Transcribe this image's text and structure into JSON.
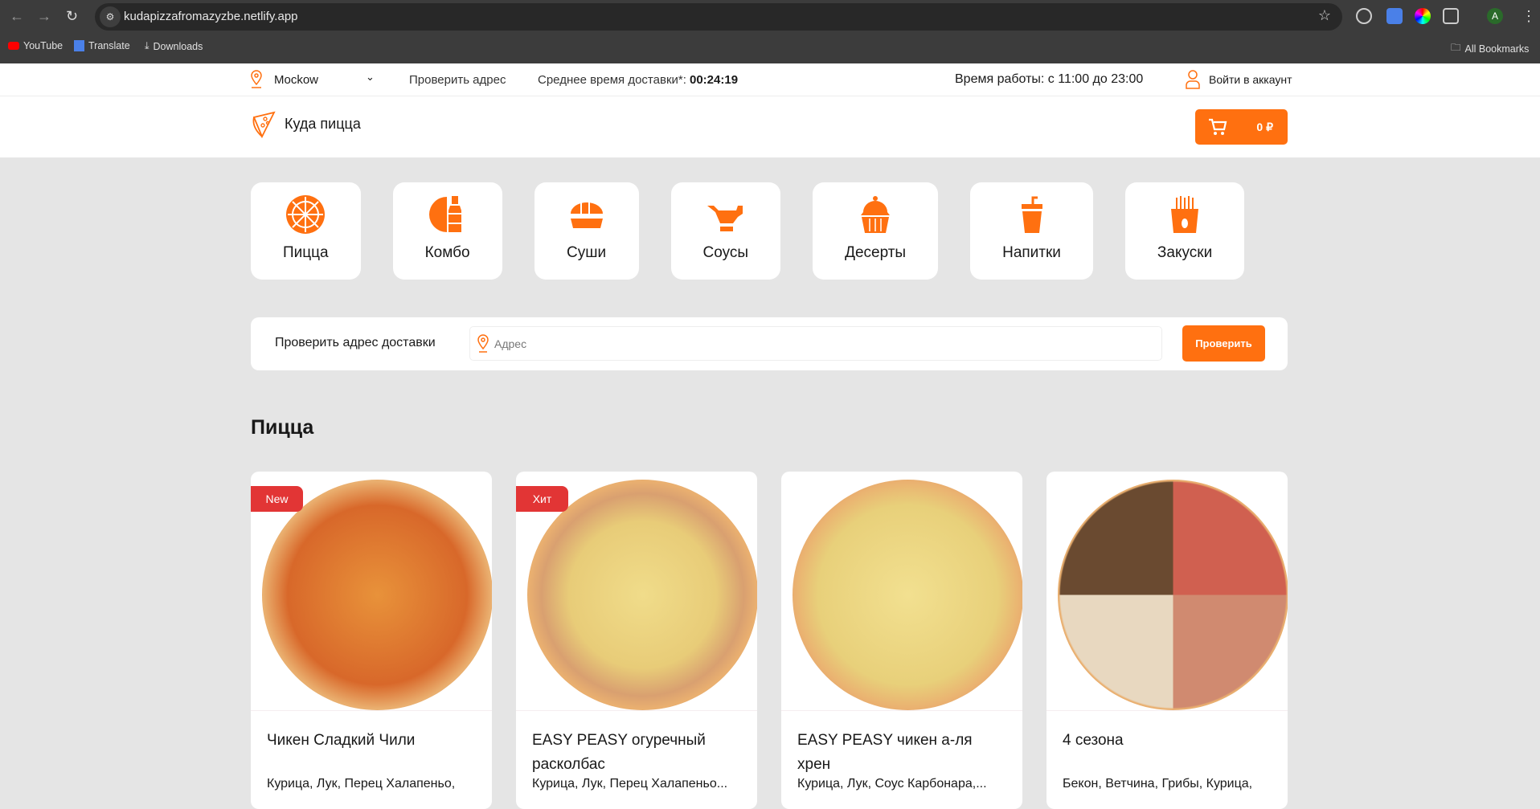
{
  "browser": {
    "url": "kudapizzafromazyzbe.netlify.app",
    "bookmarks": [
      "YouTube",
      "Translate",
      "Downloads"
    ],
    "all_bookmarks": "All Bookmarks",
    "profile": "A"
  },
  "topbar": {
    "city": "Mockow",
    "check_address": "Проверить адрес",
    "delivery_label": "Среднее время доставки*:",
    "delivery_time": "00:24:19",
    "hours": "Время работы: с 11:00 до 23:00",
    "login": "Войти в аккаунт"
  },
  "header": {
    "logo": "Куда пицца",
    "cart_total": "0 ₽"
  },
  "categories": [
    {
      "label": "Пицца"
    },
    {
      "label": "Комбо"
    },
    {
      "label": "Суши"
    },
    {
      "label": "Соусы"
    },
    {
      "label": "Десерты"
    },
    {
      "label": "Напитки"
    },
    {
      "label": "Закуски"
    }
  ],
  "address_check": {
    "label": "Проверить адрес доставки",
    "placeholder": "Адрес",
    "button": "Проверить"
  },
  "section_title": "Пицца",
  "products": [
    {
      "badge": "New",
      "title": "Чикен Сладкий Чили",
      "ingredients": "Курица, Лук, Перец Халапеньо,"
    },
    {
      "badge": "Хит",
      "title": "EASY PEASY огуречный расколбас",
      "ingredients": "Курица, Лук, Перец Халапеньо..."
    },
    {
      "title": "EASY PEASY чикен а-ля хрен",
      "ingredients": "Курица, Лук, Соус Карбонара,..."
    },
    {
      "title": "4 сезона",
      "ingredients": "Бекон, Ветчина, Грибы, Курица,"
    }
  ],
  "colors": {
    "accent": "#ff7010",
    "badge": "#e23535",
    "background": "#e5e5e5"
  }
}
